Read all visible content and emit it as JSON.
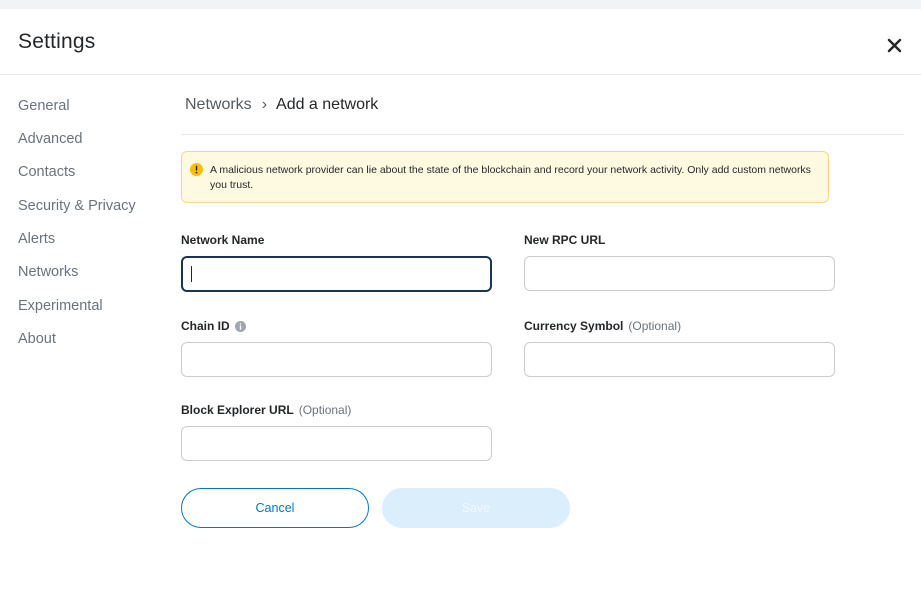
{
  "header": {
    "title": "Settings",
    "close_icon": "close-icon"
  },
  "sidebar": {
    "items": [
      {
        "label": "General"
      },
      {
        "label": "Advanced"
      },
      {
        "label": "Contacts"
      },
      {
        "label": "Security & Privacy"
      },
      {
        "label": "Alerts"
      },
      {
        "label": "Networks"
      },
      {
        "label": "Experimental"
      },
      {
        "label": "About"
      }
    ]
  },
  "breadcrumb": {
    "parent": "Networks",
    "separator": "›",
    "current": "Add a network"
  },
  "warning": {
    "icon": "warning-icon",
    "text": "A malicious network provider can lie about the state of the blockchain and record your network activity. Only add custom networks you trust.",
    "colors": {
      "background": "#fefae2",
      "border": "#f5d88c",
      "icon": "#f8c000"
    }
  },
  "form": {
    "network_name": {
      "label": "Network Name",
      "value": "",
      "placeholder": ""
    },
    "rpc_url": {
      "label": "New RPC URL",
      "value": "",
      "placeholder": ""
    },
    "chain_id": {
      "label": "Chain ID",
      "value": "",
      "placeholder": "",
      "info_icon": "info-icon"
    },
    "currency_symbol": {
      "label": "Currency Symbol",
      "optional": "(Optional)",
      "value": "",
      "placeholder": ""
    },
    "block_explorer": {
      "label": "Block Explorer URL",
      "optional": "(Optional)",
      "value": "",
      "placeholder": ""
    }
  },
  "buttons": {
    "cancel": "Cancel",
    "save": "Save"
  },
  "colors": {
    "primary": "#0376c9",
    "save_disabled_bg": "#dbeefb",
    "focus_border": "#1a3550"
  }
}
